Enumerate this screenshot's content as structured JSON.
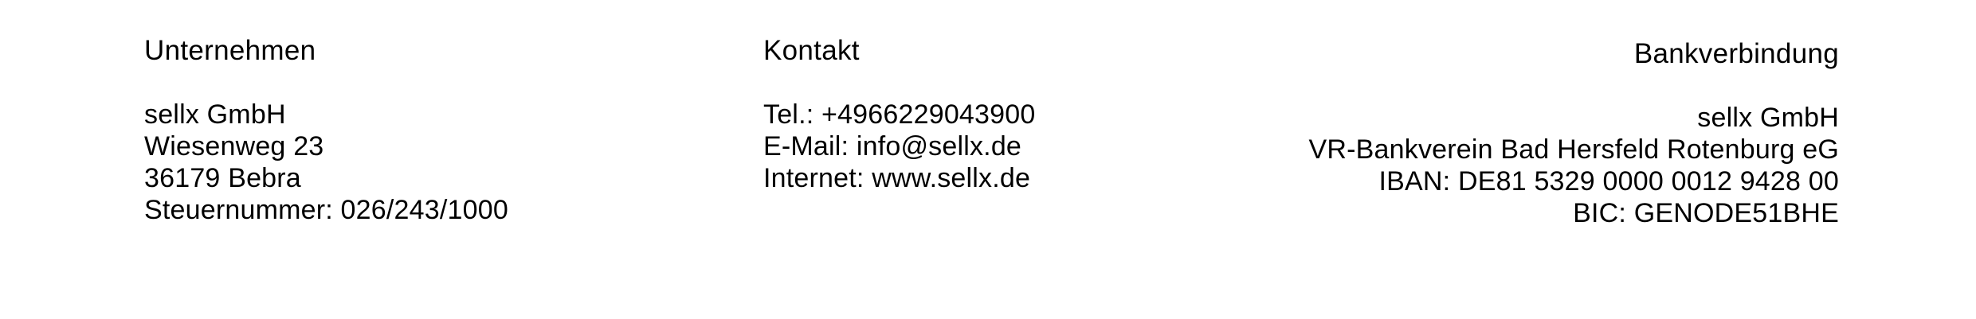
{
  "company": {
    "heading": "Unternehmen",
    "lines": [
      "sellx GmbH",
      "Wiesenweg 23",
      "36179 Bebra",
      "Steuernummer: 026/243/1000"
    ]
  },
  "contact": {
    "heading": "Kontakt",
    "lines": [
      "Tel.: +4966229043900",
      "E-Mail: info@sellx.de",
      "Internet: www.sellx.de"
    ]
  },
  "bank": {
    "heading": "Bankverbindung",
    "lines": [
      "sellx GmbH",
      "VR-Bankverein Bad Hersfeld Rotenburg eG",
      "IBAN: DE81 5329 0000 0012 9428 00",
      "BIC: GENODE51BHE"
    ]
  }
}
